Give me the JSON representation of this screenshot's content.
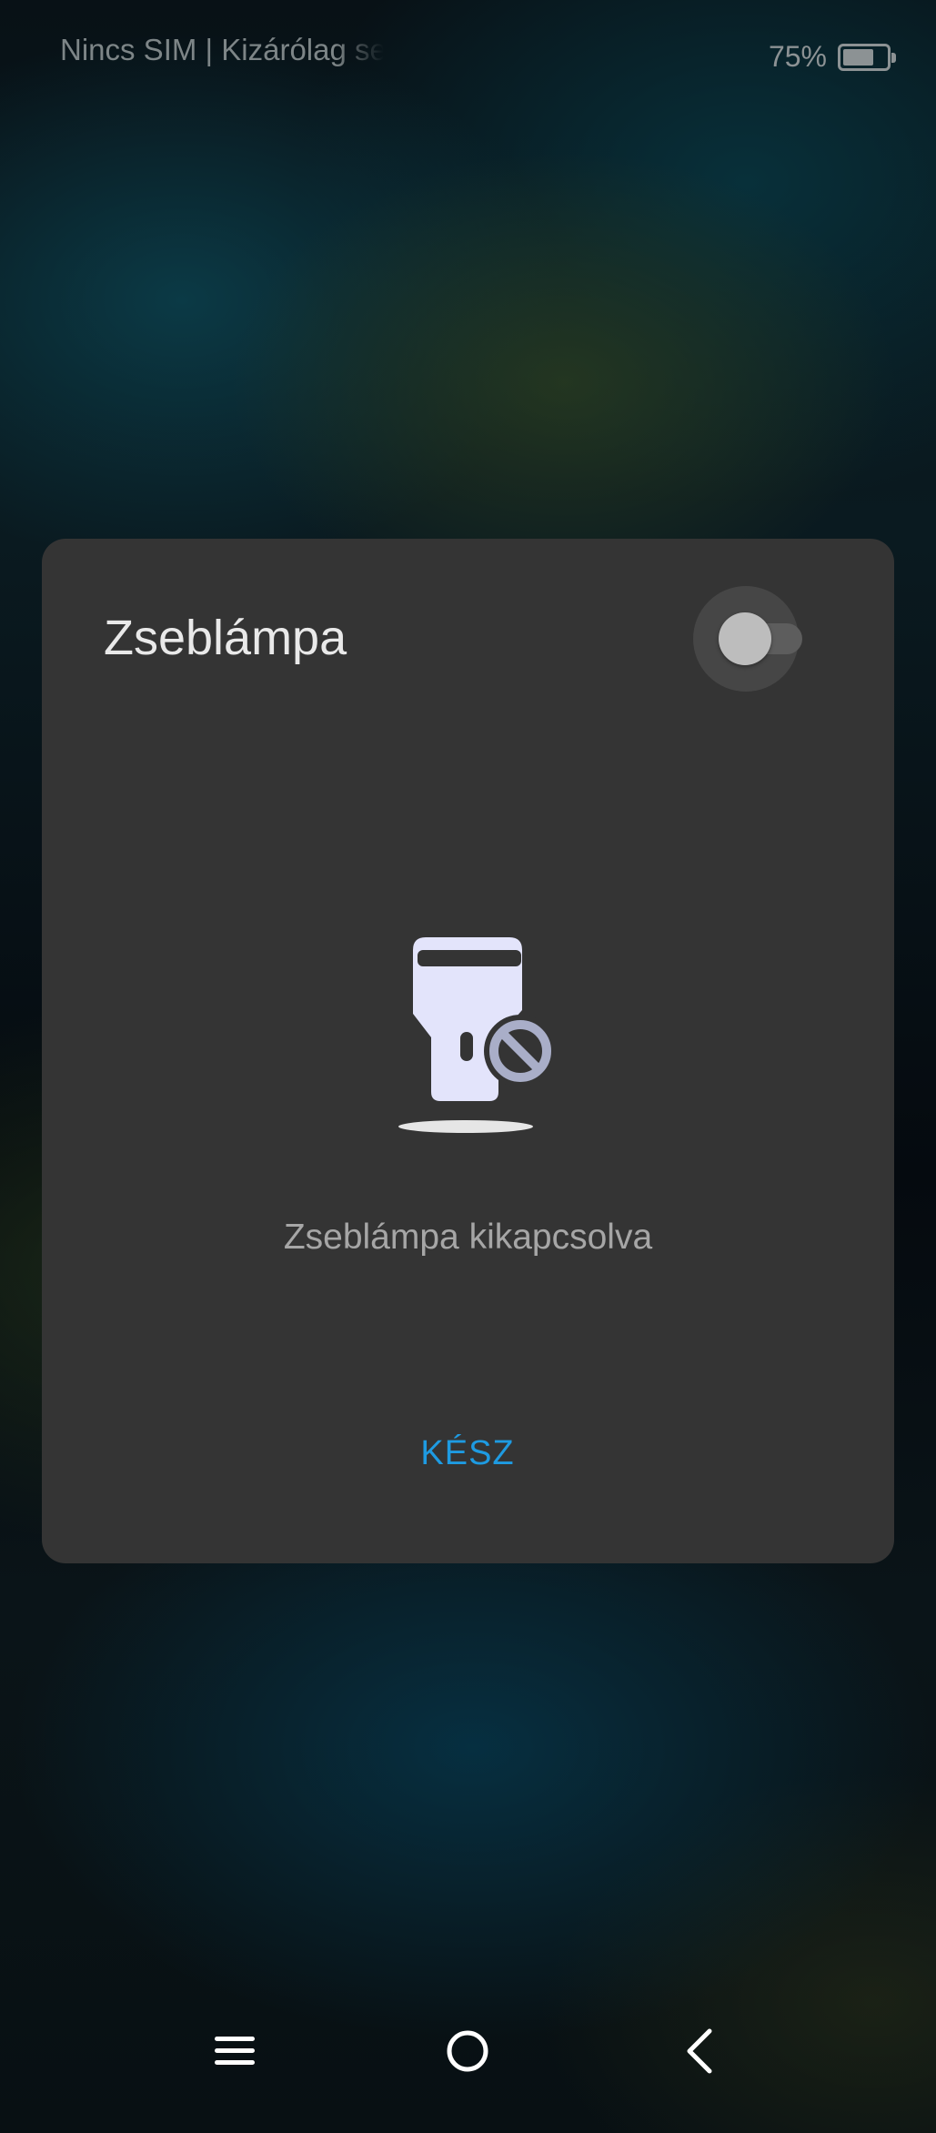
{
  "status_bar": {
    "carrier_text": "Nincs SIM | Kizárólag segélyhívás",
    "battery_percent": "75%",
    "battery_level": 0.75
  },
  "dialog": {
    "title": "Zseblámpa",
    "toggle_state": "off",
    "illustration_icon": "flashlight-off-icon",
    "message": "Zseblámpa kikapcsolva",
    "done_label": "KÉSZ",
    "accent_color": "#1e9be2"
  },
  "nav_bar": {
    "icons": [
      "menu-icon",
      "home-circle-icon",
      "back-chevron-icon"
    ]
  }
}
